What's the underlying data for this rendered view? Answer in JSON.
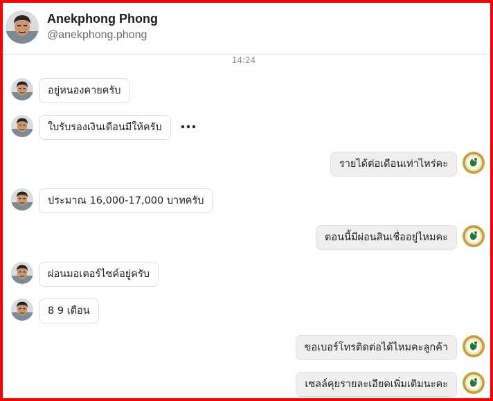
{
  "contact": {
    "name": "Anekphong Phong",
    "handle": "@anekphong.phong"
  },
  "conversation": {
    "timestamp": "14:24",
    "messages": [
      {
        "from": "contact",
        "text": "อยู่หนองคายครับ"
      },
      {
        "from": "contact",
        "text": "ใบรับรองเงินเดือนมีให้ครับ"
      },
      {
        "from": "agent",
        "text": "รายได้ต่อเดือนเท่าไหร่คะ"
      },
      {
        "from": "contact",
        "text": "ประมาณ 16,000-17,000 บาทครับ"
      },
      {
        "from": "agent",
        "text": "ตอนนี้มีผ่อนสินเชื่ออยู่ไหมคะ"
      },
      {
        "from": "contact",
        "text": "ผ่อนมอเตอร์ไซค์อยู่ครับ"
      },
      {
        "from": "contact",
        "text": "8 9 เดือน"
      },
      {
        "from": "agent",
        "text": "ขอเบอร์โทรติดต่อได้ไหมคะลูกค้า"
      },
      {
        "from": "agent",
        "text": "เซลล์คุยรายละเอียดเพิ่มเติมนะคะ"
      }
    ]
  },
  "icons": {
    "contact_avatar": "person-photo-avatar",
    "agent_avatar": "gold-green-emblem-icon",
    "more": "ellipsis-icon"
  },
  "colors": {
    "frame_border": "#ff0000",
    "incoming_bubble": "#ffffff",
    "outgoing_bubble": "#efefef"
  }
}
